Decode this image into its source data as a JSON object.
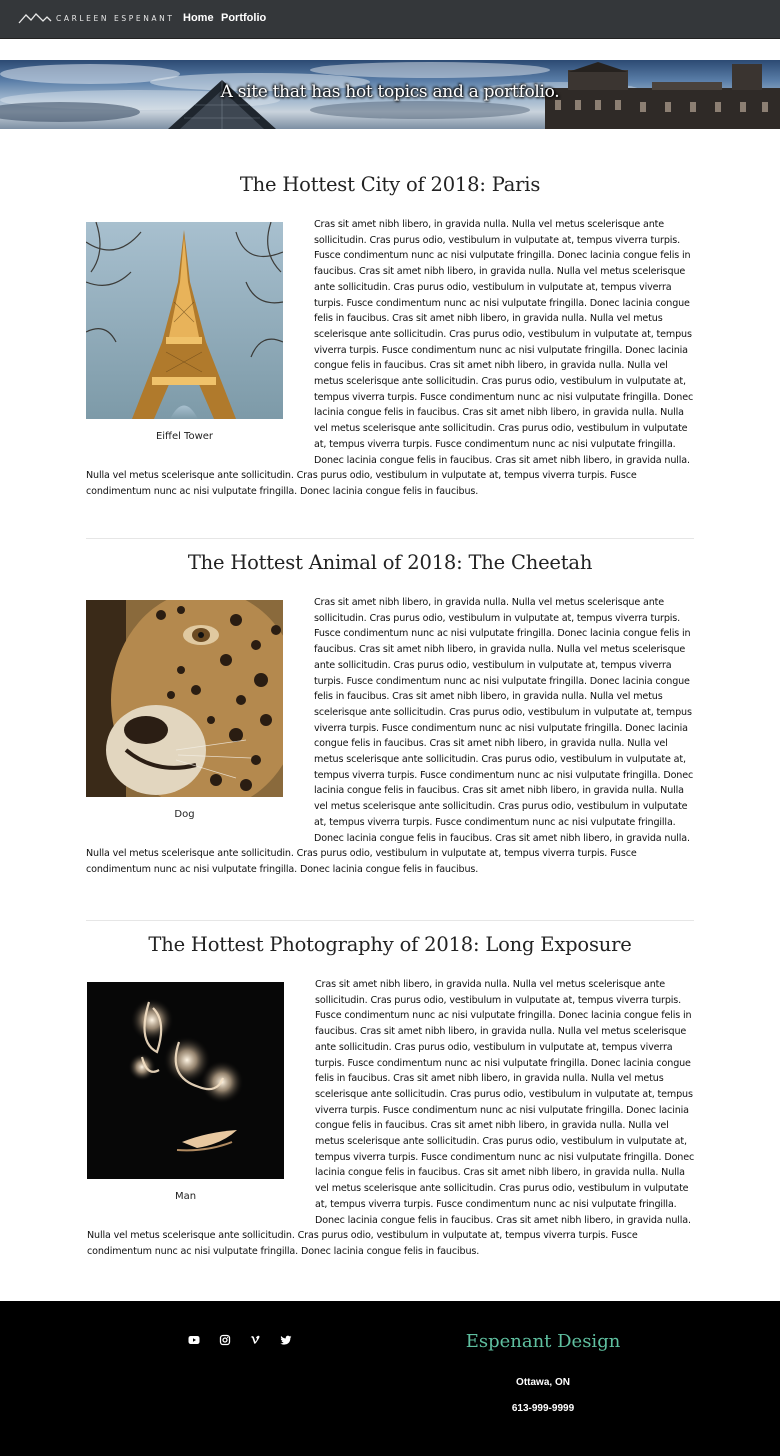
{
  "navbar": {
    "logo_text": "CARLEEN ESPENANT",
    "logo_icon": "mountain-icon",
    "links": [
      {
        "label": "Home"
      },
      {
        "label": "Portfolio"
      }
    ]
  },
  "hero": {
    "tagline": "A site that has hot topics and a portfolio."
  },
  "articles": [
    {
      "title": "The Hottest City of 2018: Paris",
      "caption": "Eiffel Tower",
      "body": "Cras sit amet nibh libero, in gravida nulla. Nulla vel metus scelerisque ante sollicitudin. Cras purus odio, vestibulum in vulputate at, tempus viverra turpis. Fusce condimentum nunc ac nisi vulputate fringilla. Donec lacinia congue felis in faucibus. Cras sit amet nibh libero, in gravida nulla. Nulla vel metus scelerisque ante sollicitudin. Cras purus odio, vestibulum in vulputate at, tempus viverra turpis. Fusce condimentum nunc ac nisi vulputate fringilla. Donec lacinia congue felis in faucibus. Cras sit amet nibh libero, in gravida nulla. Nulla vel metus scelerisque ante sollicitudin. Cras purus odio, vestibulum in vulputate at, tempus viverra turpis. Fusce condimentum nunc ac nisi vulputate fringilla. Donec lacinia congue felis in faucibus. Cras sit amet nibh libero, in gravida nulla. Nulla vel metus scelerisque ante sollicitudin. Cras purus odio, vestibulum in vulputate at, tempus viverra turpis. Fusce condimentum nunc ac nisi vulputate fringilla. Donec lacinia congue felis in faucibus. Cras sit amet nibh libero, in gravida nulla. Nulla vel metus scelerisque ante sollicitudin. Cras purus odio, vestibulum in vulputate at, tempus viverra turpis. Fusce condimentum nunc ac nisi vulputate fringilla. Donec lacinia congue felis in faucibus. Cras sit amet nibh libero, in gravida nulla. Nulla vel metus scelerisque ante sollicitudin. Cras purus odio, vestibulum in vulputate at, tempus viverra turpis. Fusce condimentum nunc ac nisi vulputate fringilla. Donec lacinia congue felis in faucibus."
    },
    {
      "title": "The Hottest Animal of 2018: The Cheetah",
      "caption": "Dog",
      "body": "Cras sit amet nibh libero, in gravida nulla. Nulla vel metus scelerisque ante sollicitudin. Cras purus odio, vestibulum in vulputate at, tempus viverra turpis. Fusce condimentum nunc ac nisi vulputate fringilla. Donec lacinia congue felis in faucibus. Cras sit amet nibh libero, in gravida nulla. Nulla vel metus scelerisque ante sollicitudin. Cras purus odio, vestibulum in vulputate at, tempus viverra turpis. Fusce condimentum nunc ac nisi vulputate fringilla. Donec lacinia congue felis in faucibus. Cras sit amet nibh libero, in gravida nulla. Nulla vel metus scelerisque ante sollicitudin. Cras purus odio, vestibulum in vulputate at, tempus viverra turpis. Fusce condimentum nunc ac nisi vulputate fringilla. Donec lacinia congue felis in faucibus. Cras sit amet nibh libero, in gravida nulla. Nulla vel metus scelerisque ante sollicitudin. Cras purus odio, vestibulum in vulputate at, tempus viverra turpis. Fusce condimentum nunc ac nisi vulputate fringilla. Donec lacinia congue felis in faucibus. Cras sit amet nibh libero, in gravida nulla. Nulla vel metus scelerisque ante sollicitudin. Cras purus odio, vestibulum in vulputate at, tempus viverra turpis. Fusce condimentum nunc ac nisi vulputate fringilla. Donec lacinia congue felis in faucibus. Cras sit amet nibh libero, in gravida nulla. Nulla vel metus scelerisque ante sollicitudin. Cras purus odio, vestibulum in vulputate at, tempus viverra turpis. Fusce condimentum nunc ac nisi vulputate fringilla. Donec lacinia congue felis in faucibus."
    },
    {
      "title": "The Hottest Photography of 2018: Long Exposure",
      "caption": "Man",
      "body": "Cras sit amet nibh libero, in gravida nulla. Nulla vel metus scelerisque ante sollicitudin. Cras purus odio, vestibulum in vulputate at, tempus viverra turpis. Fusce condimentum nunc ac nisi vulputate fringilla. Donec lacinia congue felis in faucibus. Cras sit amet nibh libero, in gravida nulla. Nulla vel metus scelerisque ante sollicitudin. Cras purus odio, vestibulum in vulputate at, tempus viverra turpis. Fusce condimentum nunc ac nisi vulputate fringilla. Donec lacinia congue felis in faucibus. Cras sit amet nibh libero, in gravida nulla. Nulla vel metus scelerisque ante sollicitudin. Cras purus odio, vestibulum in vulputate at, tempus viverra turpis. Fusce condimentum nunc ac nisi vulputate fringilla. Donec lacinia congue felis in faucibus. Cras sit amet nibh libero, in gravida nulla. Nulla vel metus scelerisque ante sollicitudin. Cras purus odio, vestibulum in vulputate at, tempus viverra turpis. Fusce condimentum nunc ac nisi vulputate fringilla. Donec lacinia congue felis in faucibus. Cras sit amet nibh libero, in gravida nulla. Nulla vel metus scelerisque ante sollicitudin. Cras purus odio, vestibulum in vulputate at, tempus viverra turpis. Fusce condimentum nunc ac nisi vulputate fringilla. Donec lacinia congue felis in faucibus. Cras sit amet nibh libero, in gravida nulla. Nulla vel metus scelerisque ante sollicitudin. Cras purus odio, vestibulum in vulputate at, tempus viverra turpis. Fusce condimentum nunc ac nisi vulputate fringilla. Donec lacinia congue felis in faucibus."
    }
  ],
  "footer": {
    "social": [
      "youtube-icon",
      "instagram-icon",
      "vimeo-icon",
      "twitter-icon"
    ],
    "brand": "Espenant Design",
    "city": "Ottawa, ON",
    "phone": "613-999-9999",
    "brand_color": "#5fc0a0"
  }
}
